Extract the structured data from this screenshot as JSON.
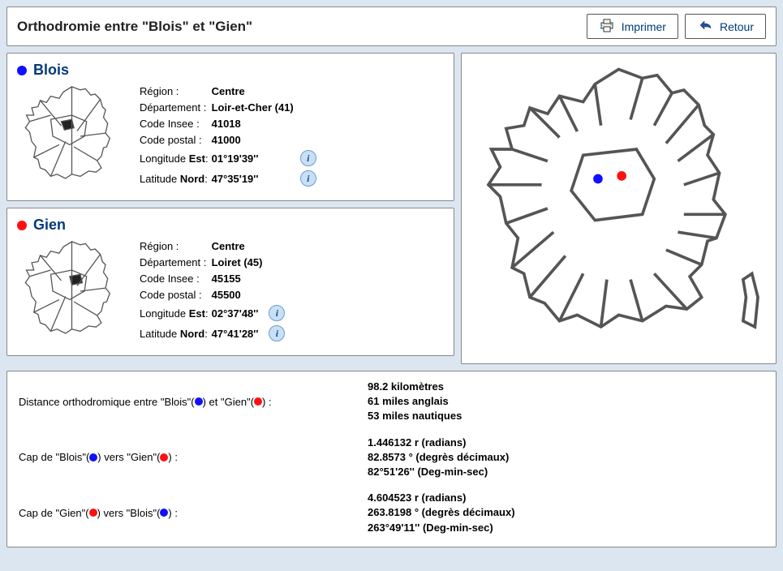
{
  "header": {
    "title": "Orthodromie entre \"Blois\" et \"Gien\"",
    "print_label": "Imprimer",
    "back_label": "Retour"
  },
  "labels": {
    "region": "Région :",
    "department": "Département :",
    "insee": "Code Insee :",
    "postal": "Code postal :",
    "longitude": "Longitude",
    "longitude_dir": "Est",
    "longitude_colon": ":",
    "latitude": "Latitude",
    "latitude_dir": "Nord",
    "latitude_colon": ":"
  },
  "cities": {
    "a": {
      "name": "Blois",
      "color": "blue",
      "region": "Centre",
      "department": "Loir-et-Cher (41)",
      "insee": "41018",
      "postal": "41000",
      "longitude": "01°19'39''",
      "latitude": "47°35'19''"
    },
    "b": {
      "name": "Gien",
      "color": "red",
      "region": "Centre",
      "department": "Loiret (45)",
      "insee": "45155",
      "postal": "45500",
      "longitude": "02°37'48''",
      "latitude": "47°41'28''"
    }
  },
  "results": {
    "distance_label_pre": "Distance orthodromique entre \"Blois\"(",
    "distance_label_mid": ") et \"Gien\"(",
    "distance_label_post": ") :",
    "distance": {
      "km": "98.2 kilomètres",
      "mi": "61 miles anglais",
      "nm": "53 miles nautiques"
    },
    "heading_ab_pre": "Cap de \"Blois\"(",
    "heading_ab_mid": ") vers \"Gien\"(",
    "heading_ab_post": ") :",
    "heading_ab": {
      "rad": "1.446132 r (radians)",
      "deg": "82.8573 ° (degrès décimaux)",
      "dms": "82°51'26'' (Deg-min-sec)"
    },
    "heading_ba_pre": "Cap de \"Gien\"(",
    "heading_ba_mid": ") vers \"Blois\"(",
    "heading_ba_post": ") :",
    "heading_ba": {
      "rad": "4.604523 r (radians)",
      "deg": "263.8198 ° (degrès décimaux)",
      "dms": "263°49'11'' (Deg-min-sec)"
    }
  }
}
